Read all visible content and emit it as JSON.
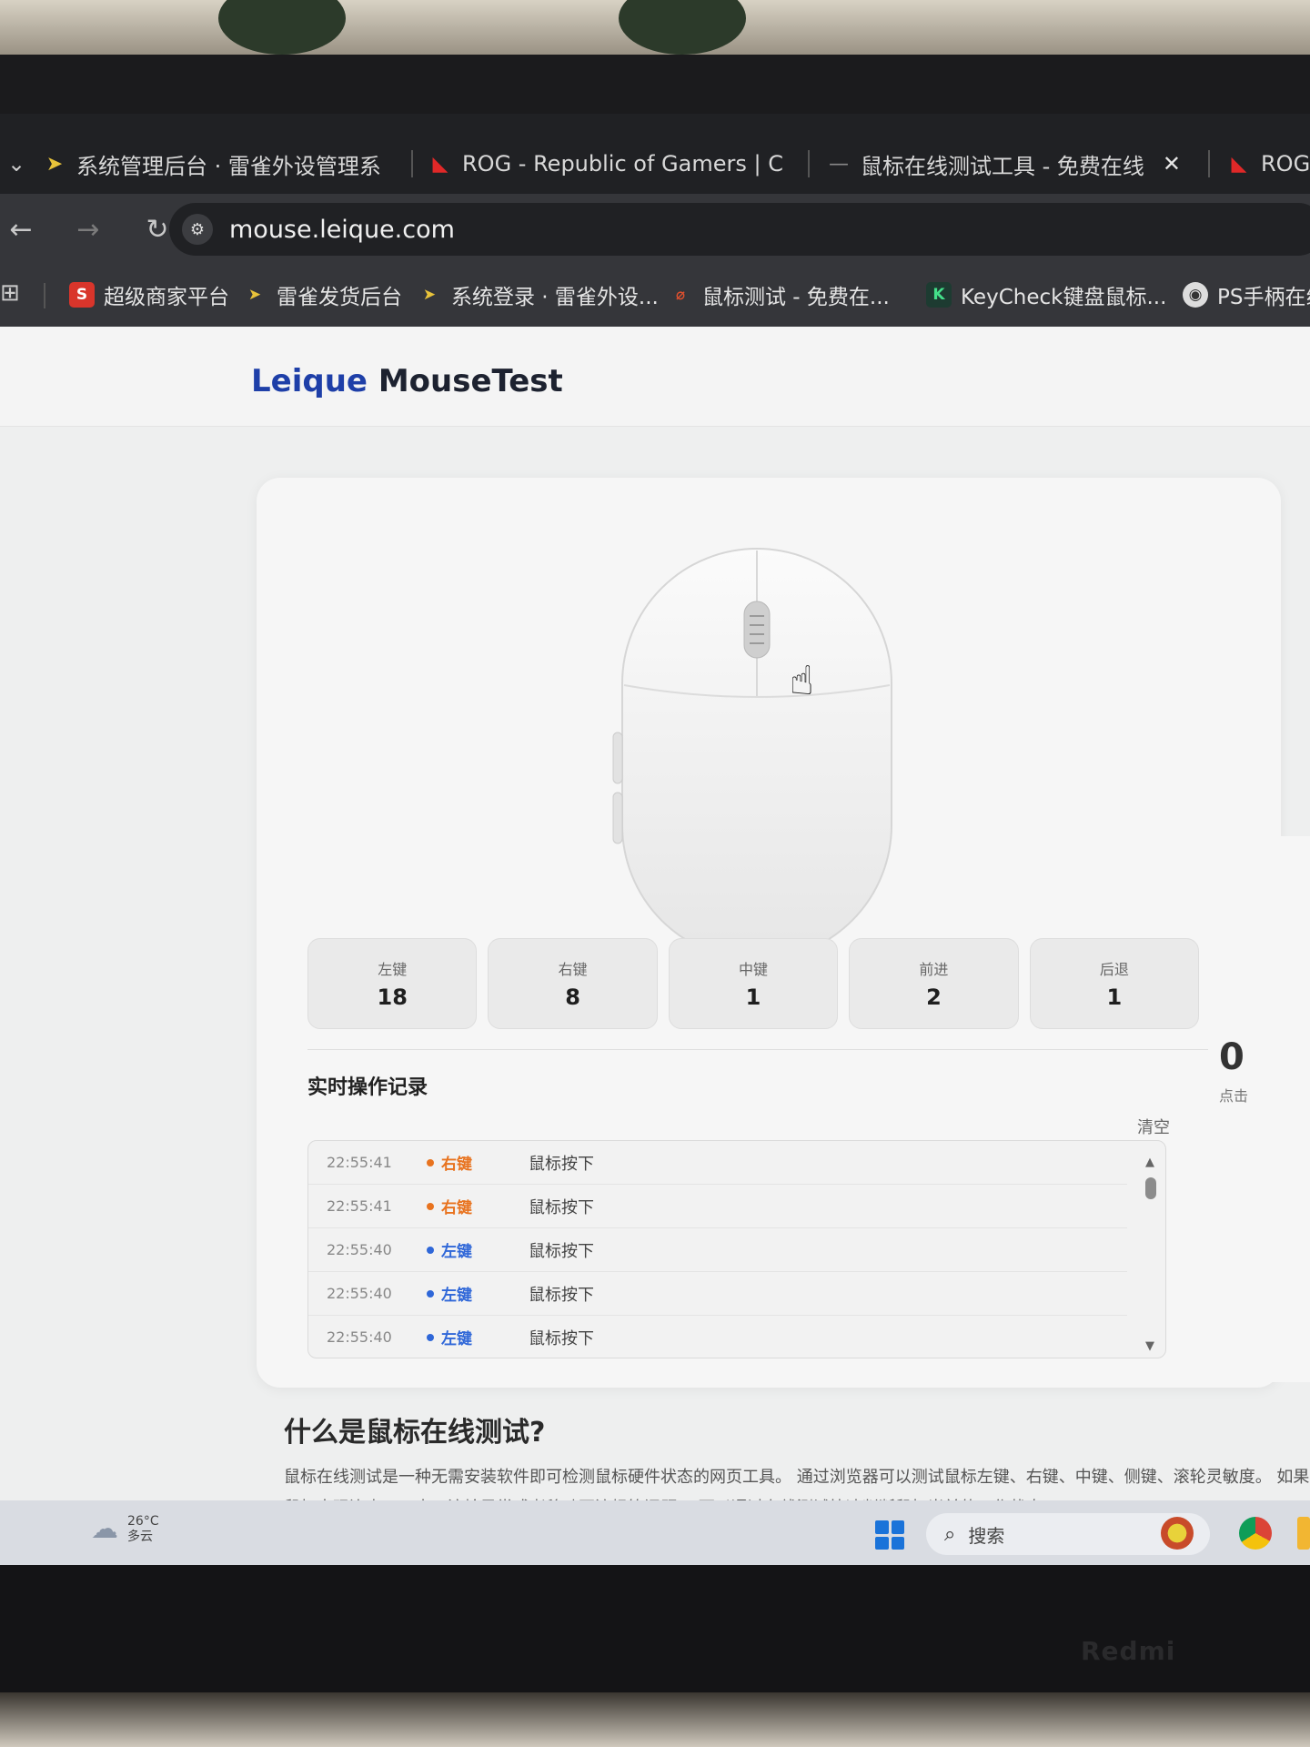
{
  "browser": {
    "tabs": [
      {
        "title": "系统管理后台 · 雷雀外设管理系",
        "icon": "leique-icon"
      },
      {
        "title": "ROG - Republic of Gamers | C",
        "icon": "rog-icon"
      },
      {
        "title": "鼠标在线测试工具 - 免费在线",
        "icon": "tab-loading-icon"
      },
      {
        "title": "ROG",
        "icon": "rog-icon"
      }
    ],
    "url": "mouse.leique.com",
    "bookmarks": [
      {
        "label": "超级商家平台",
        "icon": "S"
      },
      {
        "label": "雷雀发货后台",
        "icon": "leique-icon"
      },
      {
        "label": "系统登录 · 雷雀外设...",
        "icon": "leique-icon"
      },
      {
        "label": "鼠标测试 - 免费在...",
        "icon": "mouse-test-icon"
      },
      {
        "label": "KeyCheck键盘鼠标...",
        "icon": "K"
      },
      {
        "label": "PS手柄在线",
        "icon": "ps-icon"
      }
    ]
  },
  "site": {
    "logo_part1": "Leique",
    "logo_part2": "MouseTest"
  },
  "stats": [
    {
      "label": "左键",
      "value": "18"
    },
    {
      "label": "右键",
      "value": "8"
    },
    {
      "label": "中键",
      "value": "1"
    },
    {
      "label": "前进",
      "value": "2"
    },
    {
      "label": "后退",
      "value": "1"
    }
  ],
  "log": {
    "title": "实时操作记录",
    "clear_label": "清空",
    "rows": [
      {
        "time": "22:55:41",
        "key": "右键",
        "action": "鼠标按下",
        "color": "#e8731f"
      },
      {
        "time": "22:55:41",
        "key": "右键",
        "action": "鼠标按下",
        "color": "#e8731f"
      },
      {
        "time": "22:55:40",
        "key": "左键",
        "action": "鼠标按下",
        "color": "#2f67d8"
      },
      {
        "time": "22:55:40",
        "key": "左键",
        "action": "鼠标按下",
        "color": "#2f67d8"
      },
      {
        "time": "22:55:40",
        "key": "左键",
        "action": "鼠标按下",
        "color": "#2f67d8"
      }
    ]
  },
  "side_panel": {
    "value": "0",
    "label": "点击"
  },
  "section": {
    "title": "什么是鼠标在线测试?",
    "text": "鼠标在线测试是一种无需安装软件即可检测鼠标硬件状态的网页工具。 通过浏览器可以测试鼠标左键、右键、中键、侧键、滚轮灵敏度。 如果鼠标出现连点、双击、滚轮异常或者移动不流畅等问题， 可以通过在线测试快速判断鼠标当前的工作状态。"
  },
  "taskbar": {
    "temperature": "26°C",
    "weather": "多云",
    "search_label": "搜索"
  },
  "device_brand": "Redmi",
  "colors": {
    "accent_blue": "#1e3fa8",
    "right_key": "#e8731f",
    "left_key": "#2f67d8"
  }
}
